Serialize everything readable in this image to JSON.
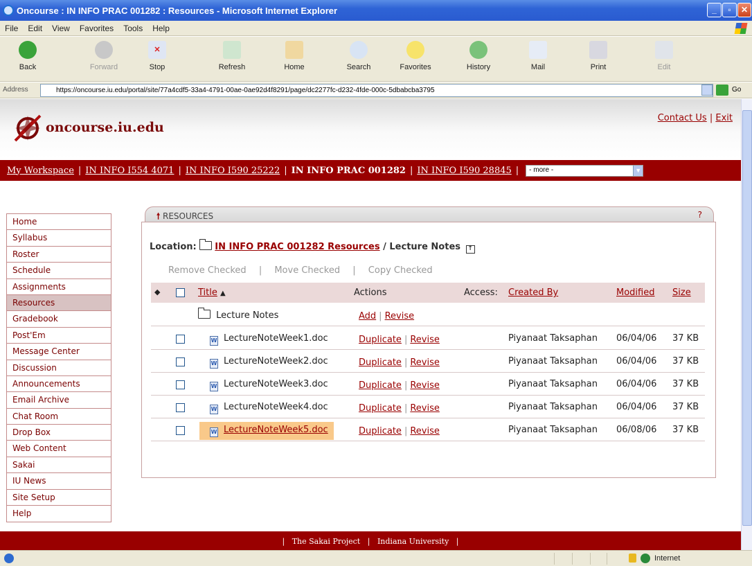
{
  "window": {
    "title": "Oncourse : IN INFO PRAC 001282 : Resources - Microsoft Internet Explorer"
  },
  "menu": [
    "File",
    "Edit",
    "View",
    "Favorites",
    "Tools",
    "Help"
  ],
  "toolbar": {
    "back": "Back",
    "forward": "Forward",
    "stop": "Stop",
    "refresh": "Refresh",
    "home": "Home",
    "search": "Search",
    "favorites": "Favorites",
    "history": "History",
    "mail": "Mail",
    "print": "Print",
    "edit": "Edit"
  },
  "address": {
    "label": "Address",
    "url": "https://oncourse.iu.edu/portal/site/77a4cdf5-33a4-4791-00ae-0ae92d4f8291/page/dc2277fc-d232-4fde-000c-5dbabcba3795",
    "go": "Go"
  },
  "site": {
    "logo_text": "oncourse.iu.edu",
    "contact": "Contact Us",
    "link_sep": "|",
    "exit": "Exit"
  },
  "tabs": {
    "items": [
      "My Workspace",
      "IN INFO I554 4071",
      "IN INFO I590 25222",
      "IN INFO PRAC 001282",
      "IN INFO I590 28845"
    ],
    "sep": "|",
    "more": "- more -"
  },
  "nav": [
    "Home",
    "Syllabus",
    "Roster",
    "Schedule",
    "Assignments",
    "Resources",
    "Gradebook",
    "Post'Em",
    "Message Center",
    "Discussion",
    "Announcements",
    "Email Archive",
    "Chat Room",
    "Drop Box",
    "Web Content",
    "Sakai",
    "IU News",
    "Site Setup",
    "Help"
  ],
  "resources": {
    "tool_title": "RESOURCES",
    "help": "?",
    "location_label": "Location:",
    "location_link": "IN INFO PRAC 001282 Resources",
    "location_rest": "/ Lecture Notes",
    "actions": {
      "remove": "Remove Checked",
      "move": "Move Checked",
      "copy": "Copy Checked",
      "sep": "|"
    },
    "columns": {
      "title": "Title",
      "actions": "Actions",
      "access": "Access:",
      "created_by": "Created By",
      "modified": "Modified",
      "size": "Size"
    },
    "folder": {
      "name": "Lecture Notes",
      "add": "Add",
      "sep": "|",
      "revise": "Revise"
    },
    "action_labels": {
      "duplicate": "Duplicate",
      "sep": "|",
      "revise": "Revise"
    },
    "rows": [
      {
        "name": "LectureNoteWeek1.doc",
        "created_by": "Piyanaat Taksaphan",
        "modified": "06/04/06",
        "size": "37 KB"
      },
      {
        "name": "LectureNoteWeek2.doc",
        "created_by": "Piyanaat Taksaphan",
        "modified": "06/04/06",
        "size": "37 KB"
      },
      {
        "name": "LectureNoteWeek3.doc",
        "created_by": "Piyanaat Taksaphan",
        "modified": "06/04/06",
        "size": "37 KB"
      },
      {
        "name": "LectureNoteWeek4.doc",
        "created_by": "Piyanaat Taksaphan",
        "modified": "06/04/06",
        "size": "37 KB"
      },
      {
        "name": "LectureNoteWeek5.doc",
        "created_by": "Piyanaat Taksaphan",
        "modified": "06/08/06",
        "size": "37 KB"
      }
    ]
  },
  "footer": {
    "sep": "|",
    "sakai": "The Sakai Project",
    "iu": "Indiana University"
  },
  "status": {
    "zone": "Internet"
  }
}
